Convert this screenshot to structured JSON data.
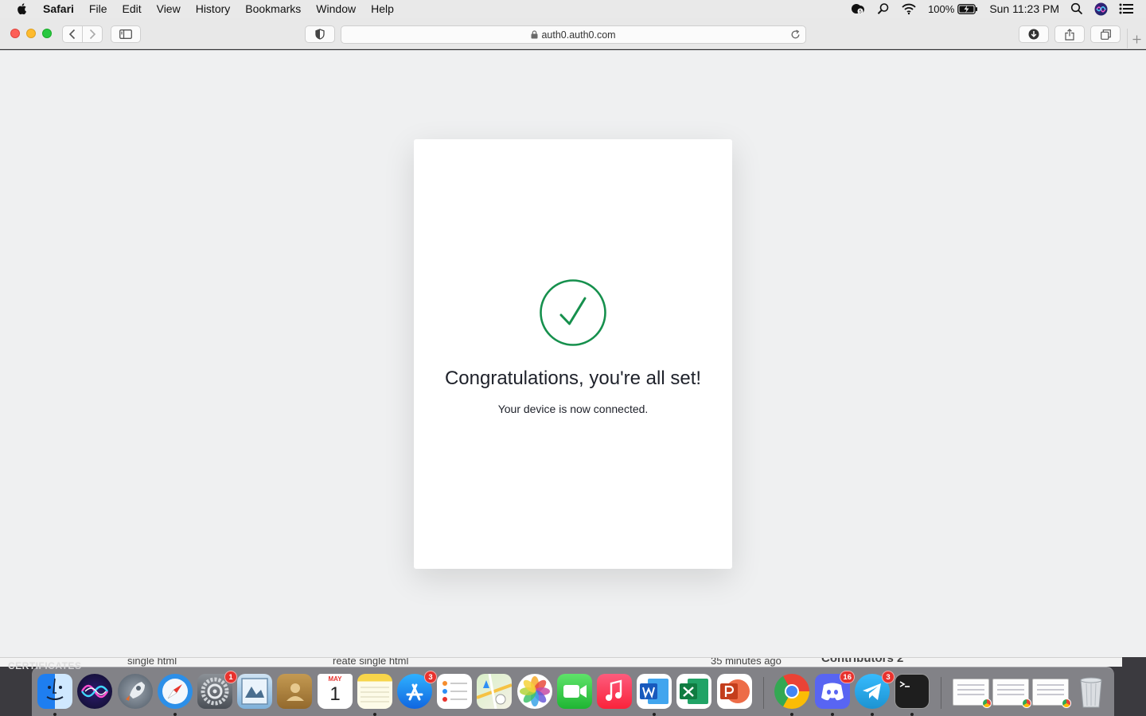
{
  "menubar": {
    "app_name": "Safari",
    "items": [
      "File",
      "Edit",
      "View",
      "History",
      "Bookmarks",
      "Window",
      "Help"
    ],
    "battery_percent": "100%",
    "clock": "Sun 11:23 PM"
  },
  "browser": {
    "url": "auth0.auth0.com"
  },
  "card": {
    "title": "Congratulations, you're all set!",
    "subtitle": "Your device is now connected.",
    "icon": "check-circle-icon",
    "accent_color": "#16904d"
  },
  "background_window": {
    "label": "CERTIFICATES",
    "cells": [
      "single html",
      "reate single html",
      "35 minutes ago",
      "Contributors  2"
    ]
  },
  "dock": {
    "apps": [
      {
        "name": "finder-icon",
        "dot": true
      },
      {
        "name": "siri-icon",
        "dot": false
      },
      {
        "name": "launchpad-icon",
        "dot": false
      },
      {
        "name": "safari-icon",
        "dot": true
      },
      {
        "name": "system-preferences-icon",
        "dot": false,
        "badge": "1"
      },
      {
        "name": "preview-icon",
        "dot": false
      },
      {
        "name": "contacts-icon",
        "dot": false
      },
      {
        "name": "calendar-icon",
        "dot": false,
        "month": "MAY",
        "day": "1"
      },
      {
        "name": "notes-icon",
        "dot": true
      },
      {
        "name": "app-store-icon",
        "dot": false,
        "badge": "3"
      },
      {
        "name": "reminders-icon",
        "dot": false
      },
      {
        "name": "maps-icon",
        "dot": false
      },
      {
        "name": "photos-icon",
        "dot": false
      },
      {
        "name": "facetime-icon",
        "dot": false
      },
      {
        "name": "music-icon",
        "dot": false
      },
      {
        "name": "word-icon",
        "dot": true
      },
      {
        "name": "excel-icon",
        "dot": false
      },
      {
        "name": "powerpoint-icon",
        "dot": false
      },
      {
        "name": "chrome-icon",
        "dot": true
      },
      {
        "name": "discord-icon",
        "dot": true,
        "badge": "16"
      },
      {
        "name": "telegram-icon",
        "dot": true,
        "badge": "3"
      },
      {
        "name": "terminal-icon",
        "dot": true
      }
    ],
    "badges": {
      "system_preferences": "1",
      "app_store": "3",
      "discord": "16",
      "telegram": "3"
    },
    "calendar": {
      "month": "MAY",
      "day": "1"
    }
  }
}
